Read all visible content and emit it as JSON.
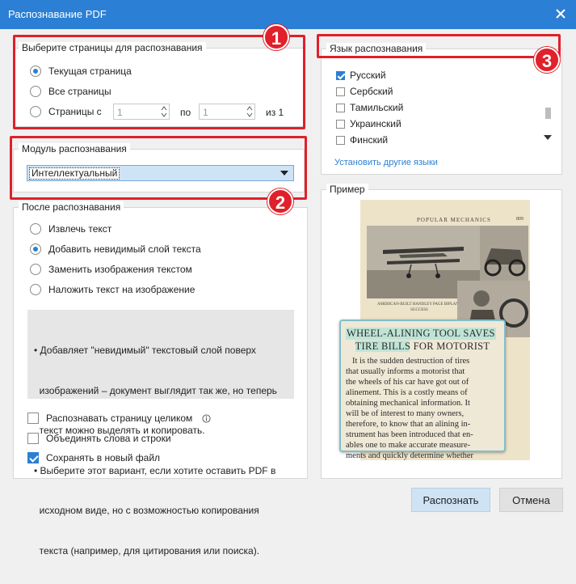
{
  "window": {
    "title": "Распознавание PDF"
  },
  "pages_group": {
    "legend": "Выберите страницы для распознавания",
    "current_page": "Текущая страница",
    "all_pages": "Все страницы",
    "range_label": "Страницы с",
    "range_from": "1",
    "range_to_label": "по",
    "range_to": "1",
    "range_of": "из 1",
    "selected": "current_page"
  },
  "module_group": {
    "legend": "Модуль распознавания",
    "selected_value": "Интеллектуальный"
  },
  "after_group": {
    "legend": "После распознавания",
    "options": [
      "Извлечь текст",
      "Добавить невидимый слой текста",
      "Заменить изображения текстом",
      "Наложить текст на изображение"
    ],
    "selected_index": 1,
    "info_lines": [
      "• Добавляет \"невидимый\" текстовый слой поверх",
      "  изображений – документ выглядит так же, но теперь",
      "  текст можно выделять и копировать.",
      "• Выберите этот вариант, если хотите оставить PDF в",
      "  исходном виде, но с возможностью копирования",
      "  текста (например, для цитирования или поиска)."
    ]
  },
  "checkboxes": {
    "whole_page": "Распознавать страницу целиком",
    "merge_words": "Объединять слова и строки",
    "save_new_file": "Сохранять в новый файл"
  },
  "language_group": {
    "legend": "Язык распознавания",
    "languages": [
      {
        "label": "Русский",
        "checked": true
      },
      {
        "label": "Сербский",
        "checked": false
      },
      {
        "label": "Тамильский",
        "checked": false
      },
      {
        "label": "Украинский",
        "checked": false
      },
      {
        "label": "Финский",
        "checked": false
      }
    ],
    "install_link": "Установить другие языки"
  },
  "example_group": {
    "legend": "Пример",
    "magazine_title": "POPULAR MECHANICS",
    "page_number": "809",
    "caption": "AMERICAN-BUILT HANDLEY PAGE BIPLANE SUCCESS",
    "headline_1": "WHEEL-ALINING TOOL SAVES",
    "headline_2": "TIRE BILLS FOR MOTORIST",
    "body_lines": [
      "It is the sudden destruction of tires",
      "that usually informs a motorist that",
      "the wheels of his car have got out of",
      "alinement. This is a costly means of",
      "obtaining mechanical information. It",
      "will be of interest to many owners,",
      "therefore, to know that an alining in-",
      "strument has been introduced that en-",
      "ables one to make accurate measure-",
      "ments and quickly determine whether"
    ]
  },
  "annotations": [
    "1",
    "2",
    "3"
  ],
  "buttons": {
    "recognize": "Распознать",
    "cancel": "Отмена"
  },
  "colors": {
    "accent": "#2b7fd4",
    "highlight": "#e0202a"
  }
}
